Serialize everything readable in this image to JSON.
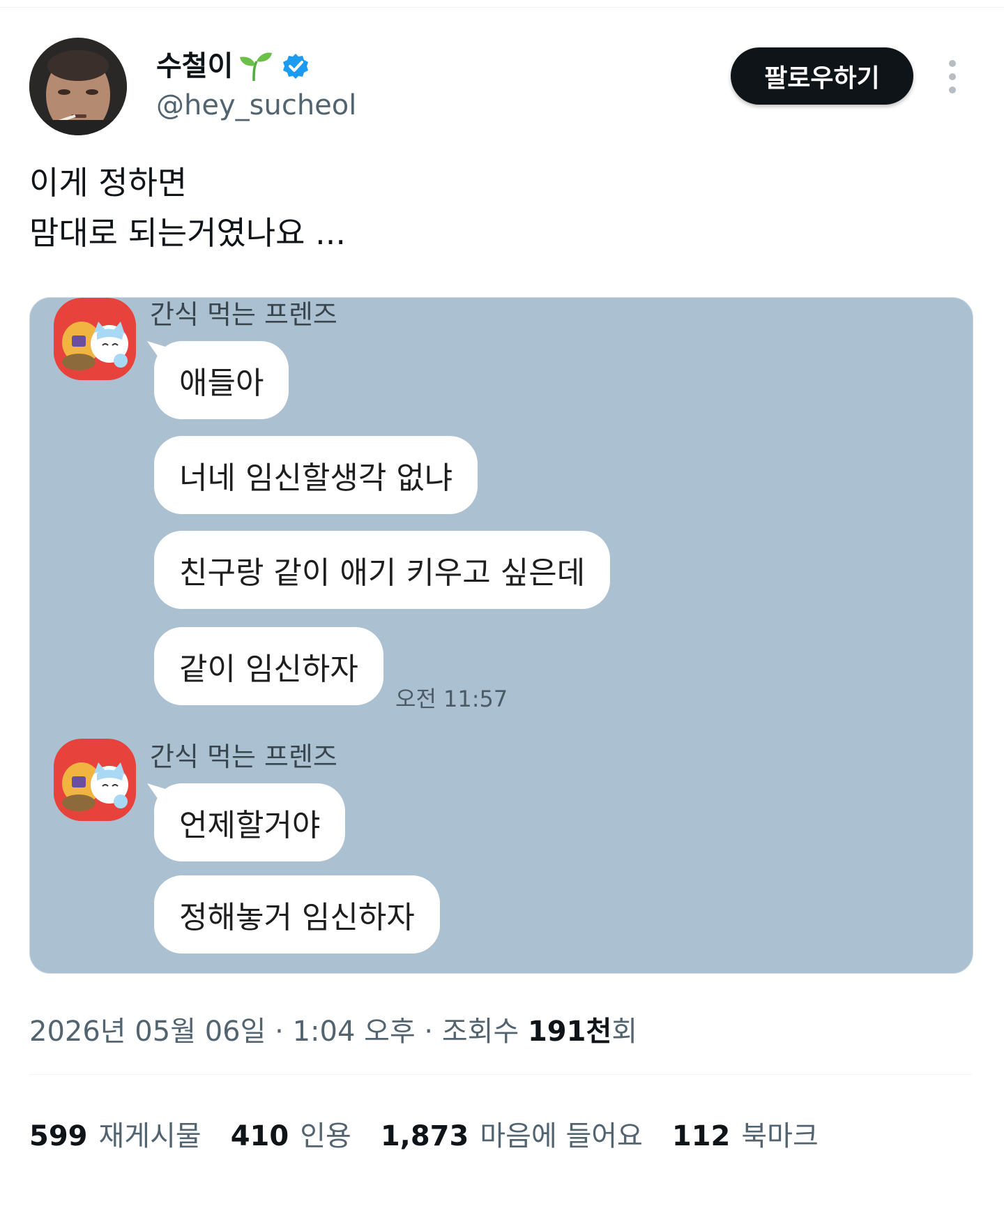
{
  "author": {
    "display_name": "수철이",
    "handle": "@hey_sucheol"
  },
  "follow_label": "팔로우하기",
  "tweet": {
    "lines": [
      "이게 정하면",
      "맘대로 되는거였나요 ..."
    ]
  },
  "chat": {
    "groups": [
      {
        "sender": "간식 먹는 프렌즈",
        "messages": [
          "애들아",
          "너네 임신할생각 없냐",
          "친구랑 같이 애기 키우고 싶은데",
          "같이 임신하자"
        ],
        "time": "오전 11:57"
      },
      {
        "sender": "간식 먹는 프렌즈",
        "messages": [
          "언제할거야",
          "정해놓거 임신하자"
        ]
      }
    ]
  },
  "meta": {
    "date_time": "2026년 05월 06일 · 1:04 오후 · 조회수 ",
    "views_count": "191천",
    "views_suffix": "회"
  },
  "stats": {
    "reposts": {
      "count": "599",
      "label": "재게시물"
    },
    "quotes": {
      "count": "410",
      "label": "인용"
    },
    "likes": {
      "count": "1,873",
      "label": "마음에 들어요"
    },
    "bookmarks": {
      "count": "112",
      "label": "북마크"
    }
  },
  "colors": {
    "verified": "#1d9bf0",
    "follow_button": "#0f1419",
    "chat_background": "#abc1d1",
    "chat_avatar": "#e8423d"
  }
}
